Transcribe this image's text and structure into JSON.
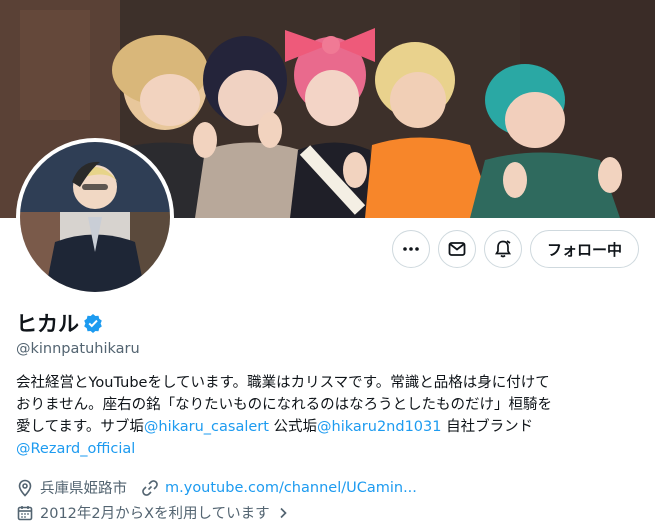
{
  "profile": {
    "display_name": "ヒカル",
    "verified": true,
    "handle": "@kinnpatuhikaru",
    "bio": {
      "line1": "会社経営とYouTubeをしています。職業はカリスマです。常識と品格は身に付けて",
      "line2": "おりません。座右の銘「なりたいものになれるのはなろうとしたものだけ」桓騎を",
      "line3_prefix": "愛してます。サブ垢",
      "link_sub": "@hikaru_casalert",
      "mid_text": " 公式垢",
      "link_official": "@hikaru2nd1031",
      "suffix_text": " 自社ブランド",
      "link_brand": "@Rezard_official"
    },
    "location": "兵庫県姫路市",
    "website": "m.youtube.com/channel/UCamin...",
    "joined": "2012年2月からXを利用しています"
  },
  "actions": {
    "follow_label": "フォロー中"
  },
  "icons": {
    "more": "more-dots-icon",
    "message": "mail-icon",
    "notify": "bell-icon",
    "verified": "verified-badge-icon",
    "location": "location-pin-icon",
    "link": "link-icon",
    "calendar": "calendar-icon",
    "chevron": "chevron-right-icon"
  },
  "colors": {
    "link": "#1d9bf0",
    "secondary_text": "#536471",
    "border": "#cfd9de"
  }
}
